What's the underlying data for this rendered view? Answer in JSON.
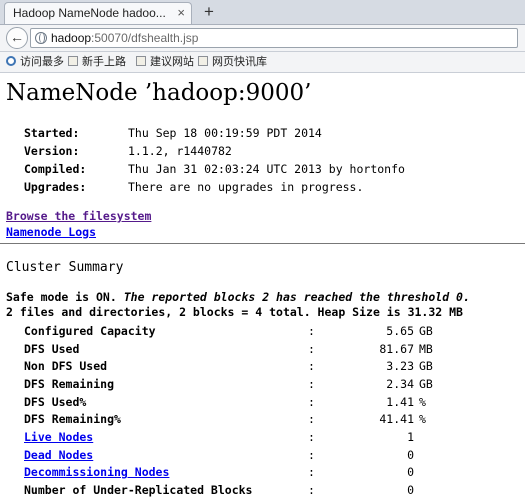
{
  "browser": {
    "tab_title": "Hadoop NameNode hadoo...",
    "close_glyph": "×",
    "new_tab_glyph": "+",
    "back_glyph": "←",
    "url_host": "hadoop",
    "url_rest": ":50070/dfshealth.jsp",
    "bookmarks": [
      {
        "label": "访问最多",
        "icon": "gear-icon"
      },
      {
        "label": "新手上路",
        "icon": "page-icon"
      },
      {
        "label": "建议网站",
        "icon": "page-icon"
      },
      {
        "label": "网页快讯库",
        "icon": "page-icon"
      }
    ]
  },
  "page": {
    "title": "NameNode ’hadoop:9000’",
    "info": [
      {
        "key": "Started:",
        "value": "Thu Sep 18 00:19:59 PDT 2014"
      },
      {
        "key": "Version:",
        "value": "1.1.2, r1440782"
      },
      {
        "key": "Compiled:",
        "value": "Thu Jan 31 02:03:24 UTC 2013 by hortonfo"
      },
      {
        "key": "Upgrades:",
        "value": "There are no upgrades in progress."
      }
    ],
    "links": {
      "browse": "Browse the filesystem",
      "logs": "Namenode Logs"
    },
    "cluster_summary": {
      "heading": "Cluster Summary",
      "safe_mode_prefix": "Safe mode is ON.",
      "safe_mode_detail": "The reported blocks 2 has reached the threshold 0.",
      "summary": "2 files and directories, 2 blocks = 4 total. Heap Size is 31.32 MB",
      "colon": ":",
      "rows": [
        {
          "name": "Configured Capacity",
          "value": "5.65",
          "unit": "GB"
        },
        {
          "name": "DFS Used",
          "value": "81.67",
          "unit": "MB"
        },
        {
          "name": "Non DFS Used",
          "value": "3.23",
          "unit": "GB"
        },
        {
          "name": "DFS Remaining",
          "value": "2.34",
          "unit": "GB"
        },
        {
          "name": "DFS Used%",
          "value": "1.41",
          "unit": "%"
        },
        {
          "name": "DFS Remaining%",
          "value": "41.41",
          "unit": "%"
        },
        {
          "name": "Live Nodes",
          "value": "1",
          "unit": ""
        },
        {
          "name": "Dead Nodes",
          "value": "0",
          "unit": ""
        },
        {
          "name": "Decommissioning Nodes",
          "value": "0",
          "unit": ""
        },
        {
          "name": "Number of Under-Replicated Blocks",
          "value": "0",
          "unit": ""
        }
      ]
    }
  },
  "colors": {
    "link": "#0000ee",
    "visited_link": "#551a8b",
    "chrome_bg": "#f3f4f6",
    "tabstrip_bg": "#d6dbe3"
  }
}
